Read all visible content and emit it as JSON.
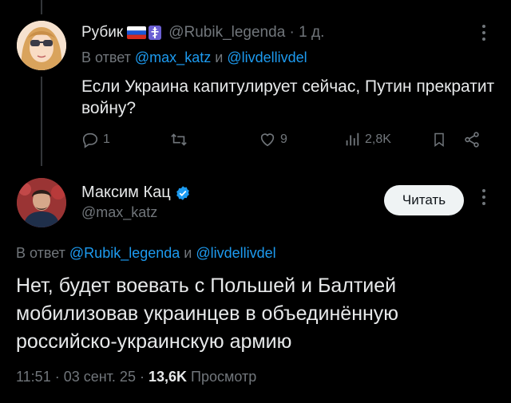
{
  "reply_tweet": {
    "display_name": "Рубик",
    "handle": "@Rubik_legenda",
    "time": "· 1 д.",
    "reply_prefix": "В ответ",
    "mentions": [
      "@max_katz",
      "@livdellivdel"
    ],
    "conjunction": "и",
    "text": "Если Украина капитулирует сейчас, Путин прекратит войну?",
    "actions": {
      "reply_count": "1",
      "retweet_count": "",
      "like_count": "9",
      "views_count": "2,8K"
    },
    "icons": [
      "russia-flag-icon",
      "orthodox-cross-icon",
      "more-icon",
      "reply-icon",
      "retweet-icon",
      "like-icon",
      "views-icon",
      "bookmark-icon",
      "share-icon"
    ]
  },
  "main_tweet": {
    "display_name": "Максим Кац",
    "handle": "@max_katz",
    "follow_label": "Читать",
    "reply_prefix": "В ответ",
    "mentions": [
      "@Rubik_legenda",
      "@livdellivdel"
    ],
    "conjunction": "и",
    "text": "Нет, будет воевать с Польшей и Балтией мобилизовав украинцев в объединённую российско-украинскую армию",
    "time": "11:51 · 03 сент. 25 ·",
    "views_count": "13,6K",
    "views_label": "Просмотр"
  },
  "colors": {
    "background": "#000000",
    "text": "#e7e9ea",
    "secondary": "#71767b",
    "accent": "#1d9bf0"
  }
}
